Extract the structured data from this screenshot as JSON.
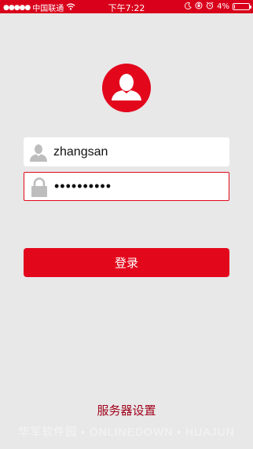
{
  "status_bar": {
    "signal_dots": "●●●●●",
    "carrier": "中国联通",
    "wifi_icon": "wifi-icon",
    "time": "下午7:22",
    "moon_icon": "moon-icon",
    "rotation_lock_icon": "rotation-lock-icon",
    "alarm_icon": "alarm-icon",
    "battery_percent": "4%",
    "battery_level": 0.04,
    "battery_color": "#ffffff"
  },
  "login": {
    "avatar_icon": "user-avatar-icon",
    "username": {
      "icon": "user-icon",
      "value": "zhangsan"
    },
    "password": {
      "icon": "lock-icon",
      "value": "••••••••••"
    },
    "submit_label": "登录"
  },
  "footer": {
    "server_settings_label": "服务器设置",
    "watermark": "华军软件园 • ONLINEDOWN • HUAJUN"
  },
  "colors": {
    "brand_red": "#e3071c",
    "status_bar_red": "#d9001b",
    "background": "#e8e8e8",
    "link_red": "#a0001a"
  }
}
